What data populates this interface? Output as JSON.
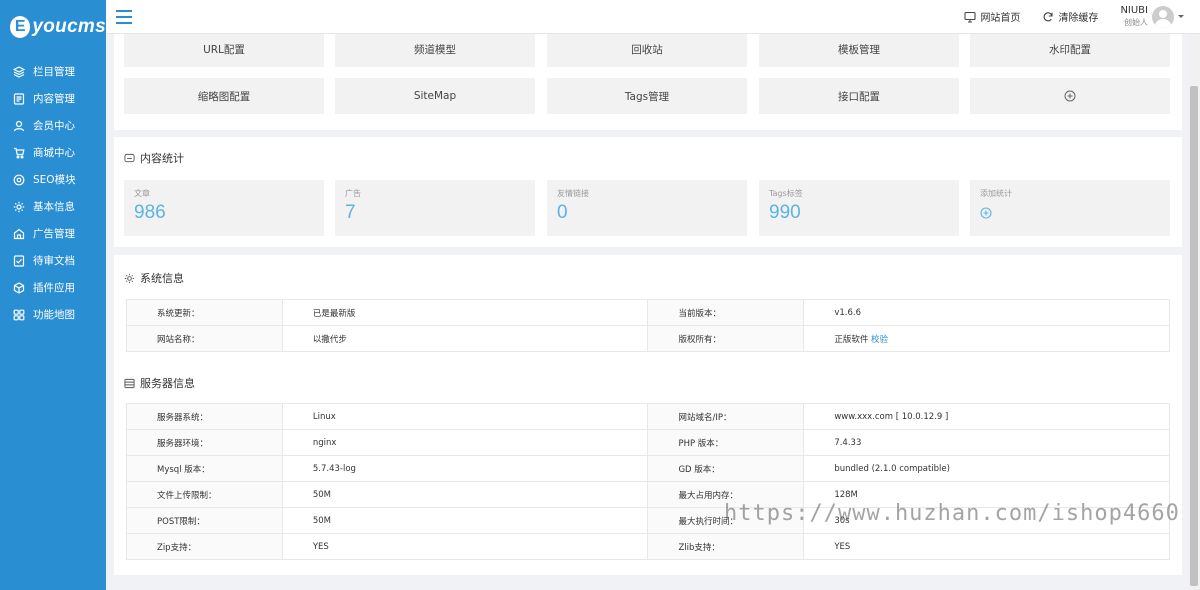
{
  "app": {
    "logo_letter": "E",
    "logo_text": "youcms"
  },
  "sidebar": {
    "items": [
      {
        "label": "栏目管理",
        "icon": "layers-icon"
      },
      {
        "label": "内容管理",
        "icon": "document-icon"
      },
      {
        "label": "会员中心",
        "icon": "user-icon"
      },
      {
        "label": "商城中心",
        "icon": "cart-icon"
      },
      {
        "label": "SEO模块",
        "icon": "seo-icon"
      },
      {
        "label": "基本信息",
        "icon": "gear-icon"
      },
      {
        "label": "广告管理",
        "icon": "ad-icon"
      },
      {
        "label": "待审文档",
        "icon": "review-icon"
      },
      {
        "label": "插件应用",
        "icon": "plugin-icon"
      },
      {
        "label": "功能地图",
        "icon": "grid-icon"
      }
    ]
  },
  "topbar": {
    "site_home": "网站首页",
    "clear_cache": "清除缓存",
    "user_name": "NIUBI",
    "user_role": "创始人"
  },
  "quick_links": [
    "URL配置",
    "频道模型",
    "回收站",
    "模板管理",
    "水印配置",
    "缩略图配置",
    "SiteMap",
    "Tags管理",
    "接口配置"
  ],
  "stats": {
    "title": "内容统计",
    "items": [
      {
        "label": "文章",
        "value": "986"
      },
      {
        "label": "广告",
        "value": "7"
      },
      {
        "label": "友情链接",
        "value": "0"
      },
      {
        "label": "Tags标签",
        "value": "990"
      }
    ],
    "add_label": "添加统计"
  },
  "system": {
    "title": "系统信息",
    "rows": [
      [
        "系统更新：",
        "已是最新版",
        "当前版本：",
        "v1.6.6"
      ],
      [
        "网站名称：",
        "以撒代步",
        "版权所有：",
        "正版软件"
      ]
    ],
    "verify_link": "校验"
  },
  "server": {
    "title": "服务器信息",
    "rows": [
      [
        "服务器系统：",
        "Linux",
        "网站域名/IP：",
        "www.xxx.com [ 10.0.12.9 ]"
      ],
      [
        "服务器环境：",
        "nginx",
        "PHP 版本：",
        "7.4.33"
      ],
      [
        "Mysql 版本：",
        "5.7.43-log",
        "GD 版本：",
        "bundled (2.1.0 compatible)"
      ],
      [
        "文件上传限制：",
        "50M",
        "最大占用内存：",
        "128M"
      ],
      [
        "POST限制：",
        "50M",
        "最大执行时间：",
        "30s"
      ],
      [
        "Zip支持：",
        "YES",
        "Zlib支持：",
        "YES"
      ]
    ]
  },
  "watermark": "https://www.huzhan.com/ishop4660"
}
